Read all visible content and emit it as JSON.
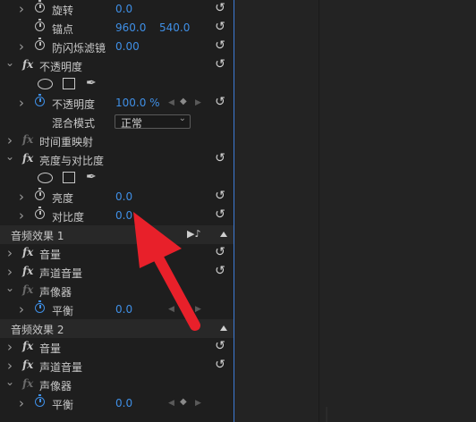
{
  "rows": {
    "rotate": {
      "label": "旋转",
      "value": "0.0"
    },
    "anchor": {
      "label": "锚点",
      "value_x": "960.0",
      "value_y": "540.0"
    },
    "antiflicker": {
      "label": "防闪烁滤镜",
      "value": "0.00"
    },
    "opacity_effect": {
      "fx": "fx",
      "label": "不透明度"
    },
    "opacity": {
      "label": "不透明度",
      "value": "100.0 %"
    },
    "blend": {
      "label": "混合模式",
      "value": "正常"
    },
    "time_remap": {
      "fx": "fx",
      "label": "时间重映射"
    },
    "bc_effect": {
      "fx": "fx",
      "label": "亮度与对比度"
    },
    "brightness": {
      "label": "亮度",
      "value": "0.0"
    },
    "contrast": {
      "label": "对比度",
      "value": "0.0"
    },
    "audio1": {
      "label": "音频效果 1"
    },
    "a1_volume": {
      "fx": "fx",
      "label": "音量"
    },
    "a1_channel": {
      "fx": "fx",
      "label": "声道音量"
    },
    "a1_panner": {
      "fx": "fx",
      "label": "声像器"
    },
    "a1_balance": {
      "label": "平衡",
      "value": "0.0"
    },
    "audio2": {
      "label": "音频效果 2"
    },
    "a2_volume": {
      "fx": "fx",
      "label": "音量"
    },
    "a2_channel": {
      "fx": "fx",
      "label": "声道音量"
    },
    "a2_panner": {
      "fx": "fx",
      "label": "声像器"
    },
    "a2_balance": {
      "label": "平衡",
      "value": "0.0"
    }
  },
  "icons": {
    "reset": "reset-icon",
    "stopwatch": "stopwatch-icon",
    "keyframe": "keyframe-diamond-icon",
    "mask_ellipse": "ellipse-mask-icon",
    "mask_rect": "rectangle-mask-icon",
    "mask_pen": "pen-mask-icon",
    "play_audio": "play-audio-icon"
  },
  "colors": {
    "value_blue": "#3f8fe6",
    "arrow_red": "#e8202a",
    "panel_bg": "#1e1e1e",
    "divider_blue": "#3d7bd6"
  }
}
